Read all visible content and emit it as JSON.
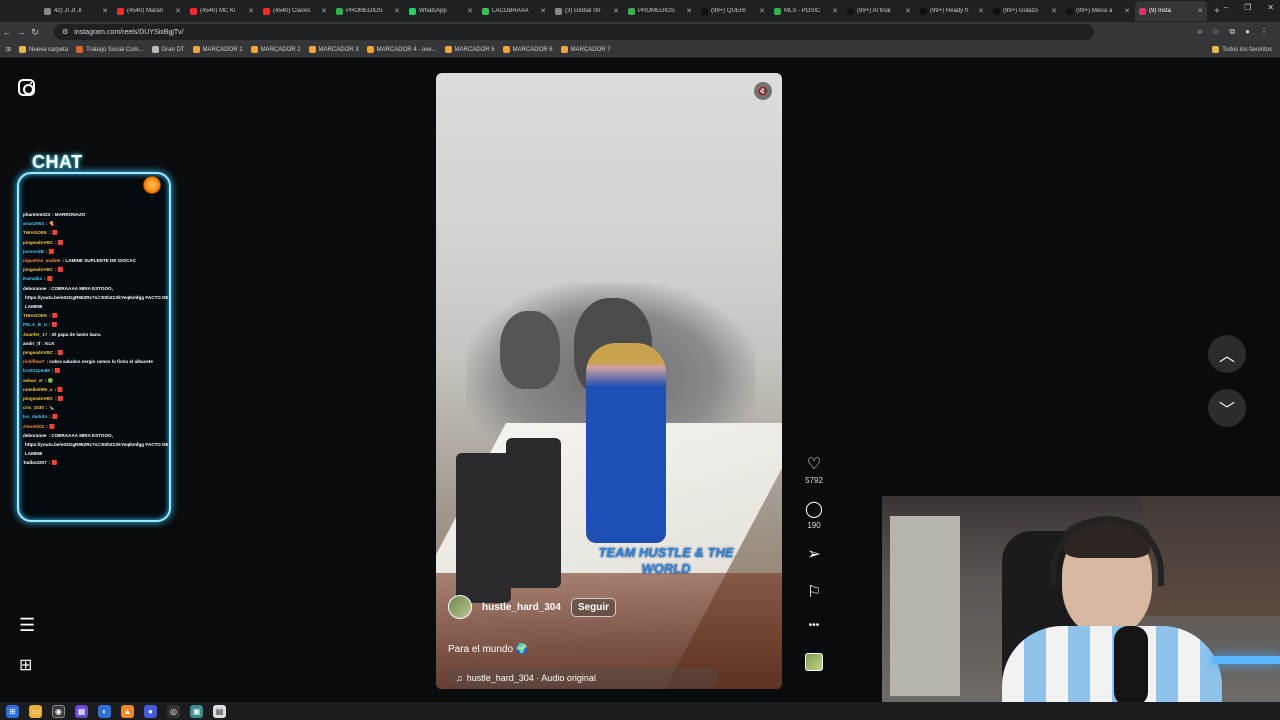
{
  "browser": {
    "tabs": [
      {
        "title": "42) JI JI JI",
        "color": "#888888"
      },
      {
        "title": "(4540) Maran",
        "color": "#ff2b2b"
      },
      {
        "title": "(4540) MC Ki",
        "color": "#ff2b2b"
      },
      {
        "title": "(4540) Claves",
        "color": "#ff2b2b"
      },
      {
        "title": "PROMEDIOS",
        "color": "#2fb34a"
      },
      {
        "title": "WhatsApp",
        "color": "#25d366"
      },
      {
        "title": "LACOBRAAA",
        "color": "#3ac24b"
      },
      {
        "title": "(3) Global Str",
        "color": "#888888"
      },
      {
        "title": "PROMEDIOS",
        "color": "#2fb34a"
      },
      {
        "title": "(99+) QUERI",
        "color": "#111111"
      },
      {
        "title": "MLS - POSIC",
        "color": "#2fb34a"
      },
      {
        "title": "(99+) Al final",
        "color": "#111111"
      },
      {
        "title": "(99+) Ready fr",
        "color": "#111111"
      },
      {
        "title": "(99+) Golazo",
        "color": "#111111"
      },
      {
        "title": "(99+) Messi a",
        "color": "#111111"
      },
      {
        "title": "(9) Insta",
        "color": "#e1306c"
      }
    ],
    "new_tab": "+",
    "window_controls": [
      "–",
      "❐",
      "✕"
    ],
    "url": "instagram.com/reels/DUYSixBgjTv/",
    "bookmarks": [
      {
        "label": "Nueva carpeta",
        "color": "#e7b84a"
      },
      {
        "label": "Trabajo Social Com...",
        "color": "#d9662b"
      },
      {
        "label": "Gran DT",
        "color": "#bbbbbb"
      },
      {
        "label": "MARCADOR 1",
        "color": "#f0a43a"
      },
      {
        "label": "MARCADOR 2",
        "color": "#f0a43a"
      },
      {
        "label": "MARCADOR 3",
        "color": "#f0a43a"
      },
      {
        "label": "MARCADOR 4 - ove...",
        "color": "#f0a43a"
      },
      {
        "label": "MARCADOR 5",
        "color": "#f0a43a"
      },
      {
        "label": "MARCADOR 6",
        "color": "#f0a43a"
      },
      {
        "label": "MARCADOR 7",
        "color": "#f0a43a"
      }
    ],
    "all_bookmarks": "Todos los favoritos"
  },
  "chat": {
    "title": "CHAT",
    "messages": [
      {
        "user": "phantom023",
        "text": ": MARRONAZO",
        "color": "#ffffff"
      },
      {
        "user": "arias2904",
        "text": ": 🍕",
        "color": "#4fc3f7"
      },
      {
        "user": "THIAGOEK",
        "text": ": 🟥",
        "color": "#f5c542"
      },
      {
        "user": "pingeadoVBC",
        "text": ": 🟥",
        "color": "#f5c542"
      },
      {
        "user": "jansondB",
        "text": ": 🟥",
        "color": "#4fc3f7"
      },
      {
        "user": "nigueline_andate",
        "text": ": LAMINE SUPLENTE DE GIOCAC",
        "color": "#ff8a3d"
      },
      {
        "user": "pingeadoVBC",
        "text": ": 🟥",
        "color": "#f5c542"
      },
      {
        "user": "Ramalbs",
        "text": ": 🟥",
        "color": "#4fc3f7"
      },
      {
        "user": "deboranoe",
        "text": ": COBRAAAA MIRA ESTOOO,",
        "color": "#ffffff"
      },
      {
        "user": "",
        "text": "https://youtu.be/o02GgR95ZRc?si=E0hZ1XkYeqIkmfgg FACTO DE",
        "color": "#ffffff"
      },
      {
        "user": "",
        "text": "LAMINE",
        "color": "#ffffff"
      },
      {
        "user": "THIAGOEK",
        "text": ": 🟥",
        "color": "#f5c542"
      },
      {
        "user": "PELA_B_U",
        "text": ": 🟥",
        "color": "#4fc3f7"
      },
      {
        "user": "Juanfer_17",
        "text": ": El papa de lamin laura",
        "color": "#f5c542"
      },
      {
        "user": "andrr_tf",
        "text": ": KLK",
        "color": "#ffffff"
      },
      {
        "user": "pingeadoVBC",
        "text": ": 🟥",
        "color": "#f5c542"
      },
      {
        "user": "richiflow7",
        "text": ": cobra saludos sergio ramos lo ficho el albacete",
        "color": "#ff8a3d"
      },
      {
        "user": "br1912pm89",
        "text": ": 🟥",
        "color": "#4fc3f7"
      },
      {
        "user": "sebas_vr",
        "text": ": 🟢",
        "color": "#f5c542"
      },
      {
        "user": "nutella09W_u",
        "text": ": 🟥",
        "color": "#f5c542"
      },
      {
        "user": "pingeadoVBC",
        "text": ": 🟥",
        "color": "#f5c542"
      },
      {
        "user": "cris_1030",
        "text": ": 🔪",
        "color": "#f5c542"
      },
      {
        "user": "lss_darkito",
        "text": ": 🟥",
        "color": "#4fc3f7"
      },
      {
        "user": "Alexel202",
        "text": ": 🟥",
        "color": "#ff8a3d"
      },
      {
        "user": "deboranoe",
        "text": ": COBRAAAA MIRA ESTOOO,",
        "color": "#ffffff"
      },
      {
        "user": "",
        "text": "https://youtu.be/o02GgR95ZRc?si=E0hZ1XkYeqIkmfgg FACTO DE",
        "color": "#ffffff"
      },
      {
        "user": "",
        "text": "LAMINE",
        "color": "#ffffff"
      },
      {
        "user": "Tadbo2207",
        "text": ": 🟥",
        "color": "#ffffff"
      }
    ]
  },
  "reel": {
    "overlay_text": "TEAM HUSTLE & THE WORLD",
    "username": "hustle_hard_304",
    "follow_label": "Seguir",
    "caption": "Para el mundo 🌍",
    "audio": "hustle_hard_304 · Audio original",
    "mute_icon": "speaker-muted-icon"
  },
  "actions": {
    "likes": "5792",
    "comments": "190"
  },
  "icons": {
    "heart": "♡",
    "comment": "◯",
    "share": "➢",
    "save": "⚐",
    "more": "•••",
    "up": "︿",
    "down": "﹀",
    "menu": "☰",
    "apps": "⊞",
    "music": "♫",
    "speaker": "🔇"
  }
}
